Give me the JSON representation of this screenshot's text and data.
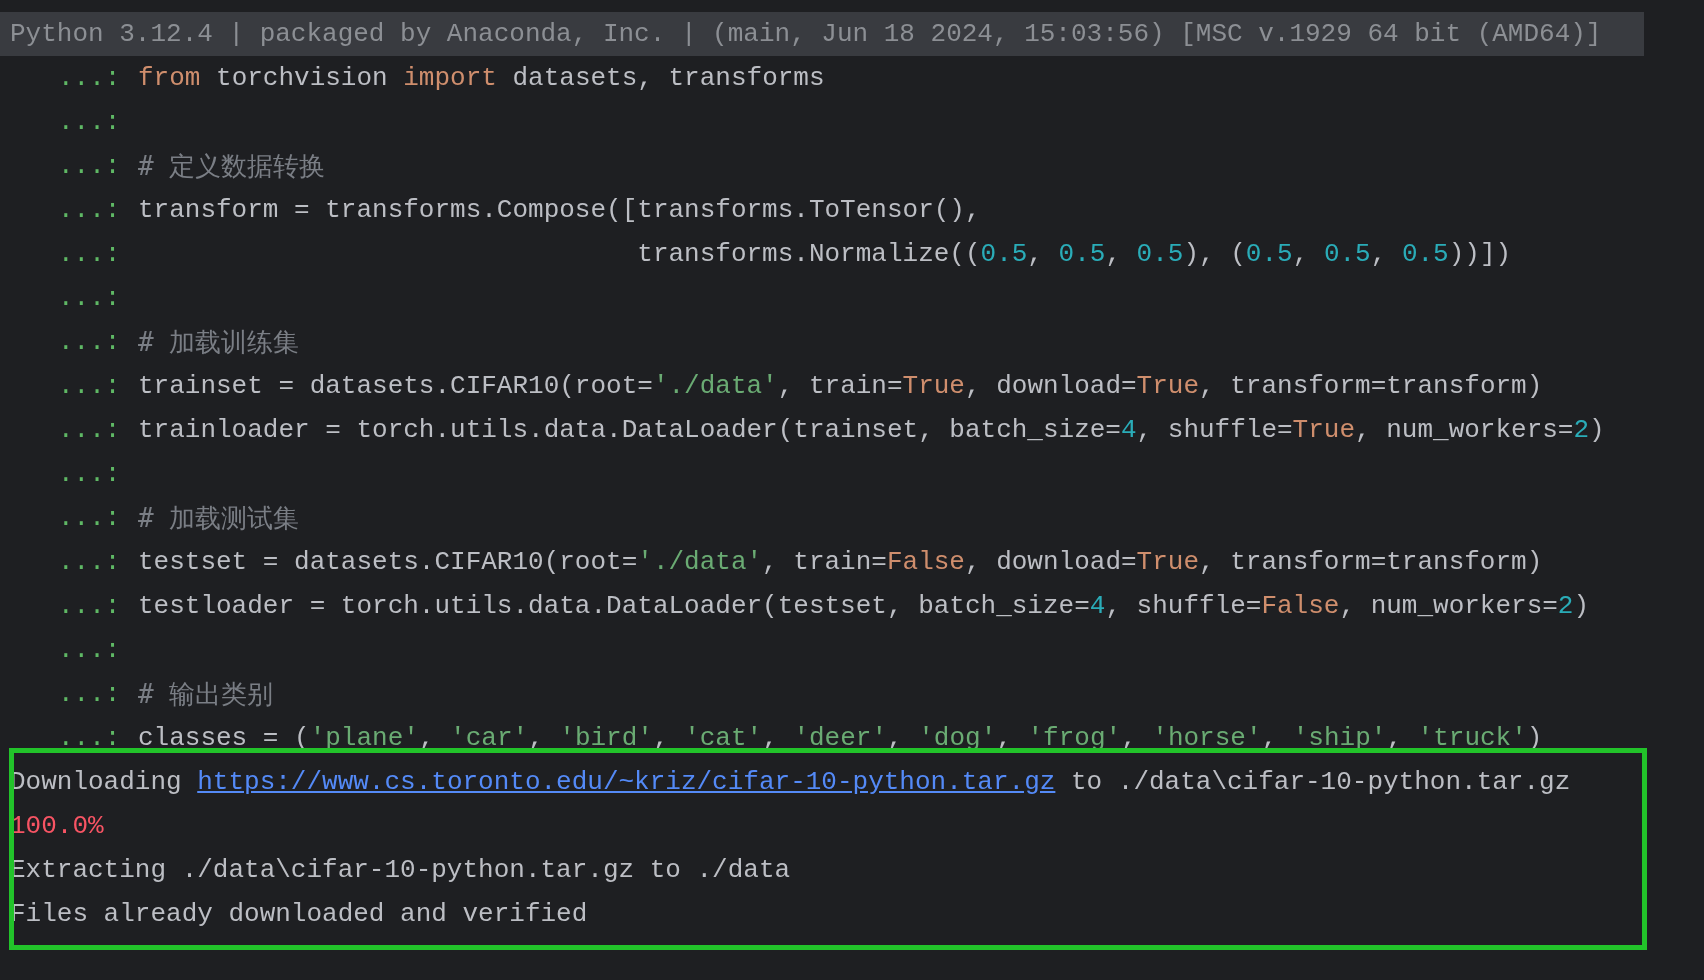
{
  "header": "Python 3.12.4 | packaged by Anaconda, Inc. | (main, Jun 18 2024, 15:03:56) [MSC v.1929 64 bit (AMD64)]",
  "code_lines": [
    {
      "prompt": "...:",
      "tokens": [
        {
          "kind": "keyword",
          "text": "from"
        },
        {
          "kind": "plain",
          "text": " torchvision "
        },
        {
          "kind": "keyword",
          "text": "import"
        },
        {
          "kind": "plain",
          "text": " datasets, transforms"
        }
      ]
    },
    {
      "prompt": "...:"
    },
    {
      "prompt": "...:",
      "tokens": [
        {
          "kind": "comment",
          "text": "# 定义数据转换"
        }
      ]
    },
    {
      "prompt": "...:",
      "tokens": [
        {
          "kind": "plain",
          "text": "transform = transforms.Compose([transforms.ToTensor(),"
        }
      ]
    },
    {
      "prompt": "...:",
      "tokens": [
        {
          "kind": "plain",
          "text": "                                transforms.Normalize(("
        },
        {
          "kind": "number",
          "text": "0.5"
        },
        {
          "kind": "plain",
          "text": ", "
        },
        {
          "kind": "number",
          "text": "0.5"
        },
        {
          "kind": "plain",
          "text": ", "
        },
        {
          "kind": "number",
          "text": "0.5"
        },
        {
          "kind": "plain",
          "text": "), ("
        },
        {
          "kind": "number",
          "text": "0.5"
        },
        {
          "kind": "plain",
          "text": ", "
        },
        {
          "kind": "number",
          "text": "0.5"
        },
        {
          "kind": "plain",
          "text": ", "
        },
        {
          "kind": "number",
          "text": "0.5"
        },
        {
          "kind": "plain",
          "text": "))])"
        }
      ]
    },
    {
      "prompt": "...:"
    },
    {
      "prompt": "...:",
      "tokens": [
        {
          "kind": "comment",
          "text": "# 加载训练集"
        }
      ]
    },
    {
      "prompt": "...:",
      "tokens": [
        {
          "kind": "plain",
          "text": "trainset = datasets.CIFAR10(root="
        },
        {
          "kind": "string",
          "text": "'./data'"
        },
        {
          "kind": "plain",
          "text": ", train="
        },
        {
          "kind": "keyword",
          "text": "True"
        },
        {
          "kind": "plain",
          "text": ", download="
        },
        {
          "kind": "keyword",
          "text": "True"
        },
        {
          "kind": "plain",
          "text": ", transform=transform)"
        }
      ]
    },
    {
      "prompt": "...:",
      "tokens": [
        {
          "kind": "plain",
          "text": "trainloader = torch.utils.data.DataLoader(trainset, batch_size="
        },
        {
          "kind": "number",
          "text": "4"
        },
        {
          "kind": "plain",
          "text": ", shuffle="
        },
        {
          "kind": "keyword",
          "text": "True"
        },
        {
          "kind": "plain",
          "text": ", num_workers="
        },
        {
          "kind": "number",
          "text": "2"
        },
        {
          "kind": "plain",
          "text": ")"
        }
      ]
    },
    {
      "prompt": "...:"
    },
    {
      "prompt": "...:",
      "tokens": [
        {
          "kind": "comment",
          "text": "# 加载测试集"
        }
      ]
    },
    {
      "prompt": "...:",
      "tokens": [
        {
          "kind": "plain",
          "text": "testset = datasets.CIFAR10(root="
        },
        {
          "kind": "string",
          "text": "'./data'"
        },
        {
          "kind": "plain",
          "text": ", train="
        },
        {
          "kind": "keyword",
          "text": "False"
        },
        {
          "kind": "plain",
          "text": ", download="
        },
        {
          "kind": "keyword",
          "text": "True"
        },
        {
          "kind": "plain",
          "text": ", transform=transform)"
        }
      ]
    },
    {
      "prompt": "...:",
      "tokens": [
        {
          "kind": "plain",
          "text": "testloader = torch.utils.data.DataLoader(testset, batch_size="
        },
        {
          "kind": "number",
          "text": "4"
        },
        {
          "kind": "plain",
          "text": ", shuffle="
        },
        {
          "kind": "keyword",
          "text": "False"
        },
        {
          "kind": "plain",
          "text": ", num_workers="
        },
        {
          "kind": "number",
          "text": "2"
        },
        {
          "kind": "plain",
          "text": ")"
        }
      ]
    },
    {
      "prompt": "...:"
    },
    {
      "prompt": "...:",
      "tokens": [
        {
          "kind": "comment",
          "text": "# 输出类别"
        }
      ]
    },
    {
      "prompt": "...:",
      "tokens": [
        {
          "kind": "plain",
          "text": "classes = ("
        },
        {
          "kind": "string",
          "text": "'plane'"
        },
        {
          "kind": "plain",
          "text": ", "
        },
        {
          "kind": "string",
          "text": "'car'"
        },
        {
          "kind": "plain",
          "text": ", "
        },
        {
          "kind": "string",
          "text": "'bird'"
        },
        {
          "kind": "plain",
          "text": ", "
        },
        {
          "kind": "string",
          "text": "'cat'"
        },
        {
          "kind": "plain",
          "text": ", "
        },
        {
          "kind": "string",
          "text": "'deer'"
        },
        {
          "kind": "plain",
          "text": ", "
        },
        {
          "kind": "string",
          "text": "'dog'"
        },
        {
          "kind": "plain",
          "text": ", "
        },
        {
          "kind": "string",
          "text": "'frog'"
        },
        {
          "kind": "plain",
          "text": ", "
        },
        {
          "kind": "string",
          "text": "'horse'"
        },
        {
          "kind": "plain",
          "text": ", "
        },
        {
          "kind": "string",
          "text": "'ship'"
        },
        {
          "kind": "plain",
          "text": ", "
        },
        {
          "kind": "string",
          "text": "'truck'"
        },
        {
          "kind": "plain",
          "text": ")"
        }
      ]
    }
  ],
  "output_lines": [
    {
      "tokens": [
        {
          "kind": "plain",
          "text": "Downloading "
        },
        {
          "kind": "link",
          "text": "https://www.cs.toronto.edu/~kriz/cifar-10-python.tar.gz"
        },
        {
          "kind": "plain",
          "text": " to ./data\\cifar-10-python.tar.gz"
        }
      ]
    },
    {
      "tokens": [
        {
          "kind": "error",
          "text": "100.0%"
        }
      ]
    },
    {
      "tokens": [
        {
          "kind": "plain",
          "text": "Extracting ./data\\cifar-10-python.tar.gz to ./data"
        }
      ]
    },
    {
      "tokens": [
        {
          "kind": "plain",
          "text": "Files already downloaded and verified"
        }
      ]
    }
  ],
  "highlight": {
    "color": "#22c32a"
  }
}
